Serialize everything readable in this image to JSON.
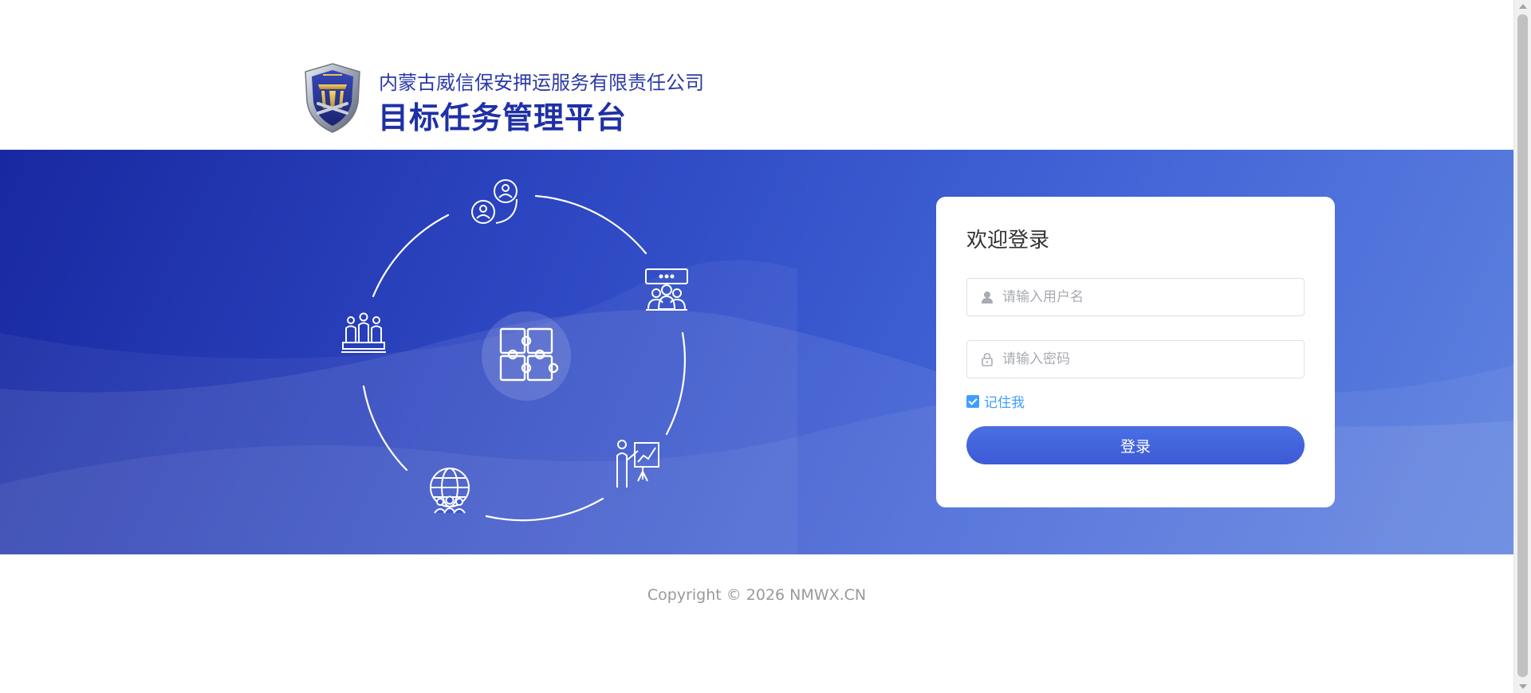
{
  "header": {
    "company_name": "内蒙古威信保安押运服务有限责任公司",
    "platform_name": "目标任务管理平台",
    "logo_icon": "shield-emblem-logo"
  },
  "illustration": {
    "center_icon": "puzzle-icon",
    "orbit_icons": [
      "users-circle-icon",
      "meeting-icon",
      "presentation-chart-icon",
      "globe-people-icon",
      "team-podium-icon"
    ]
  },
  "login": {
    "title": "欢迎登录",
    "username_placeholder": "请输入用户名",
    "username_value": "",
    "password_placeholder": "请输入密码",
    "password_value": "",
    "remember_label": "记住我",
    "remember_checked": true,
    "submit_label": "登录"
  },
  "footer": {
    "copyright": "Copyright © 2026 NMWX.CN"
  },
  "colors": {
    "brand_blue": "#1f30a6",
    "banner_start": "#1828a0",
    "banner_end": "#5f82e0",
    "accent": "#409eff",
    "button": "#3d5ad6"
  }
}
